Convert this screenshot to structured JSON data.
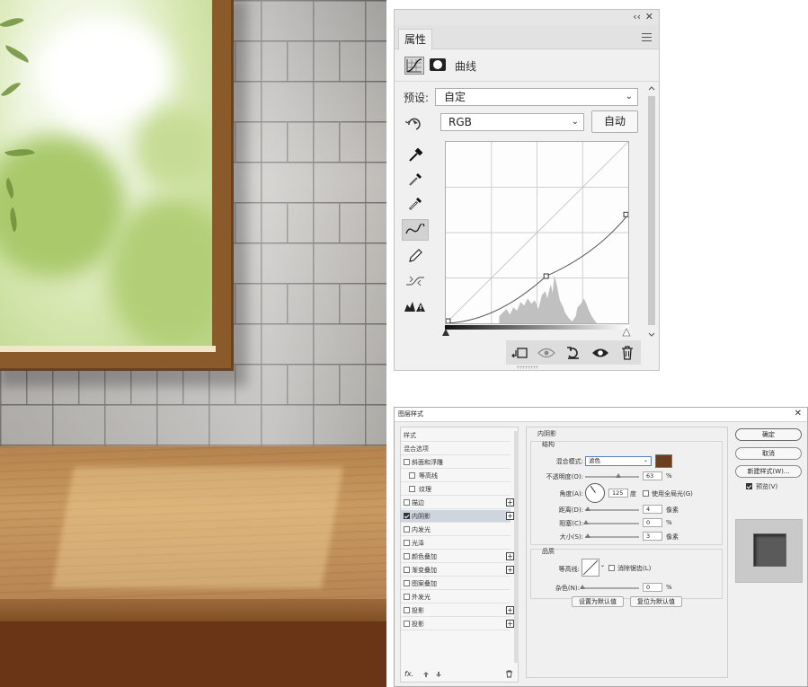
{
  "curves_panel": {
    "tab_label": "属性",
    "collapse_glyph": "‹‹",
    "close_glyph": "✕",
    "adjustment_label": "曲线",
    "preset_label": "预设:",
    "preset_value": "自定",
    "channel_value": "RGB",
    "auto_label": "自动",
    "icons": [
      "curves-adjustment-icon",
      "mask-icon",
      "panel-menu-icon",
      "on-image-adjust-icon",
      "black-point-eyedropper-icon",
      "gray-point-eyedropper-icon",
      "white-point-eyedropper-icon",
      "edit-points-curve-icon",
      "pencil-draw-icon",
      "smooth-curve-icon",
      "clipping-warning-icon",
      "clip-to-layer-icon",
      "view-previous-state-icon",
      "reset-icon",
      "visibility-icon",
      "delete-icon"
    ],
    "curve_points": [
      [
        0.0,
        0.0
      ],
      [
        0.55,
        0.26
      ],
      [
        1.0,
        0.6
      ]
    ],
    "histogram_color": "#c0c0c0"
  },
  "layer_style": {
    "title": "图层样式",
    "close_glyph": "✕",
    "list": [
      {
        "label": "样式",
        "kind": "plain"
      },
      {
        "label": "混合选项",
        "kind": "plain"
      },
      {
        "label": "斜面和浮雕",
        "kind": "check",
        "checked": false,
        "plus": false
      },
      {
        "label": "等高线",
        "kind": "sub",
        "checked": false
      },
      {
        "label": "纹理",
        "kind": "sub",
        "checked": false
      },
      {
        "label": "描边",
        "kind": "check",
        "checked": false,
        "plus": true
      },
      {
        "label": "内阴影",
        "kind": "check",
        "checked": true,
        "plus": true,
        "selected": true
      },
      {
        "label": "内发光",
        "kind": "check",
        "checked": false,
        "plus": false
      },
      {
        "label": "光泽",
        "kind": "check",
        "checked": false,
        "plus": false
      },
      {
        "label": "颜色叠加",
        "kind": "check",
        "checked": false,
        "plus": true
      },
      {
        "label": "渐变叠加",
        "kind": "check",
        "checked": false,
        "plus": true
      },
      {
        "label": "图案叠加",
        "kind": "check",
        "checked": false,
        "plus": false
      },
      {
        "label": "外发光",
        "kind": "check",
        "checked": false,
        "plus": false
      },
      {
        "label": "投影",
        "kind": "check",
        "checked": false,
        "plus": true
      },
      {
        "label": "投影",
        "kind": "check",
        "checked": false,
        "plus": true
      }
    ],
    "footer_fx": "fx.",
    "section_title": "内阴影",
    "structure_title": "结构",
    "blend_mode_label": "混合模式:",
    "blend_mode_value": "滤色",
    "shadow_color": "#6b3f1e",
    "opacity_label": "不透明度(O):",
    "opacity_value": "63",
    "angle_label": "角度(A):",
    "angle_value": "125",
    "angle_unit": "度",
    "global_light_label": "使用全局光(G)",
    "distance_label": "距离(D):",
    "distance_value": "4",
    "choke_label": "阻塞(C):",
    "choke_value": "0",
    "size_label": "大小(S):",
    "size_value": "3",
    "unit_px": "像素",
    "unit_pct": "%",
    "quality_title": "品质",
    "contour_label": "等高线:",
    "antialias_label": "消除锯齿(L)",
    "noise_label": "杂色(N):",
    "noise_value": "0",
    "make_default": "设置为默认值",
    "reset_default": "复位为默认值",
    "ok": "确定",
    "cancel": "取消",
    "new_style": "新建样式(W)...",
    "preview_label": "预览(V)"
  }
}
